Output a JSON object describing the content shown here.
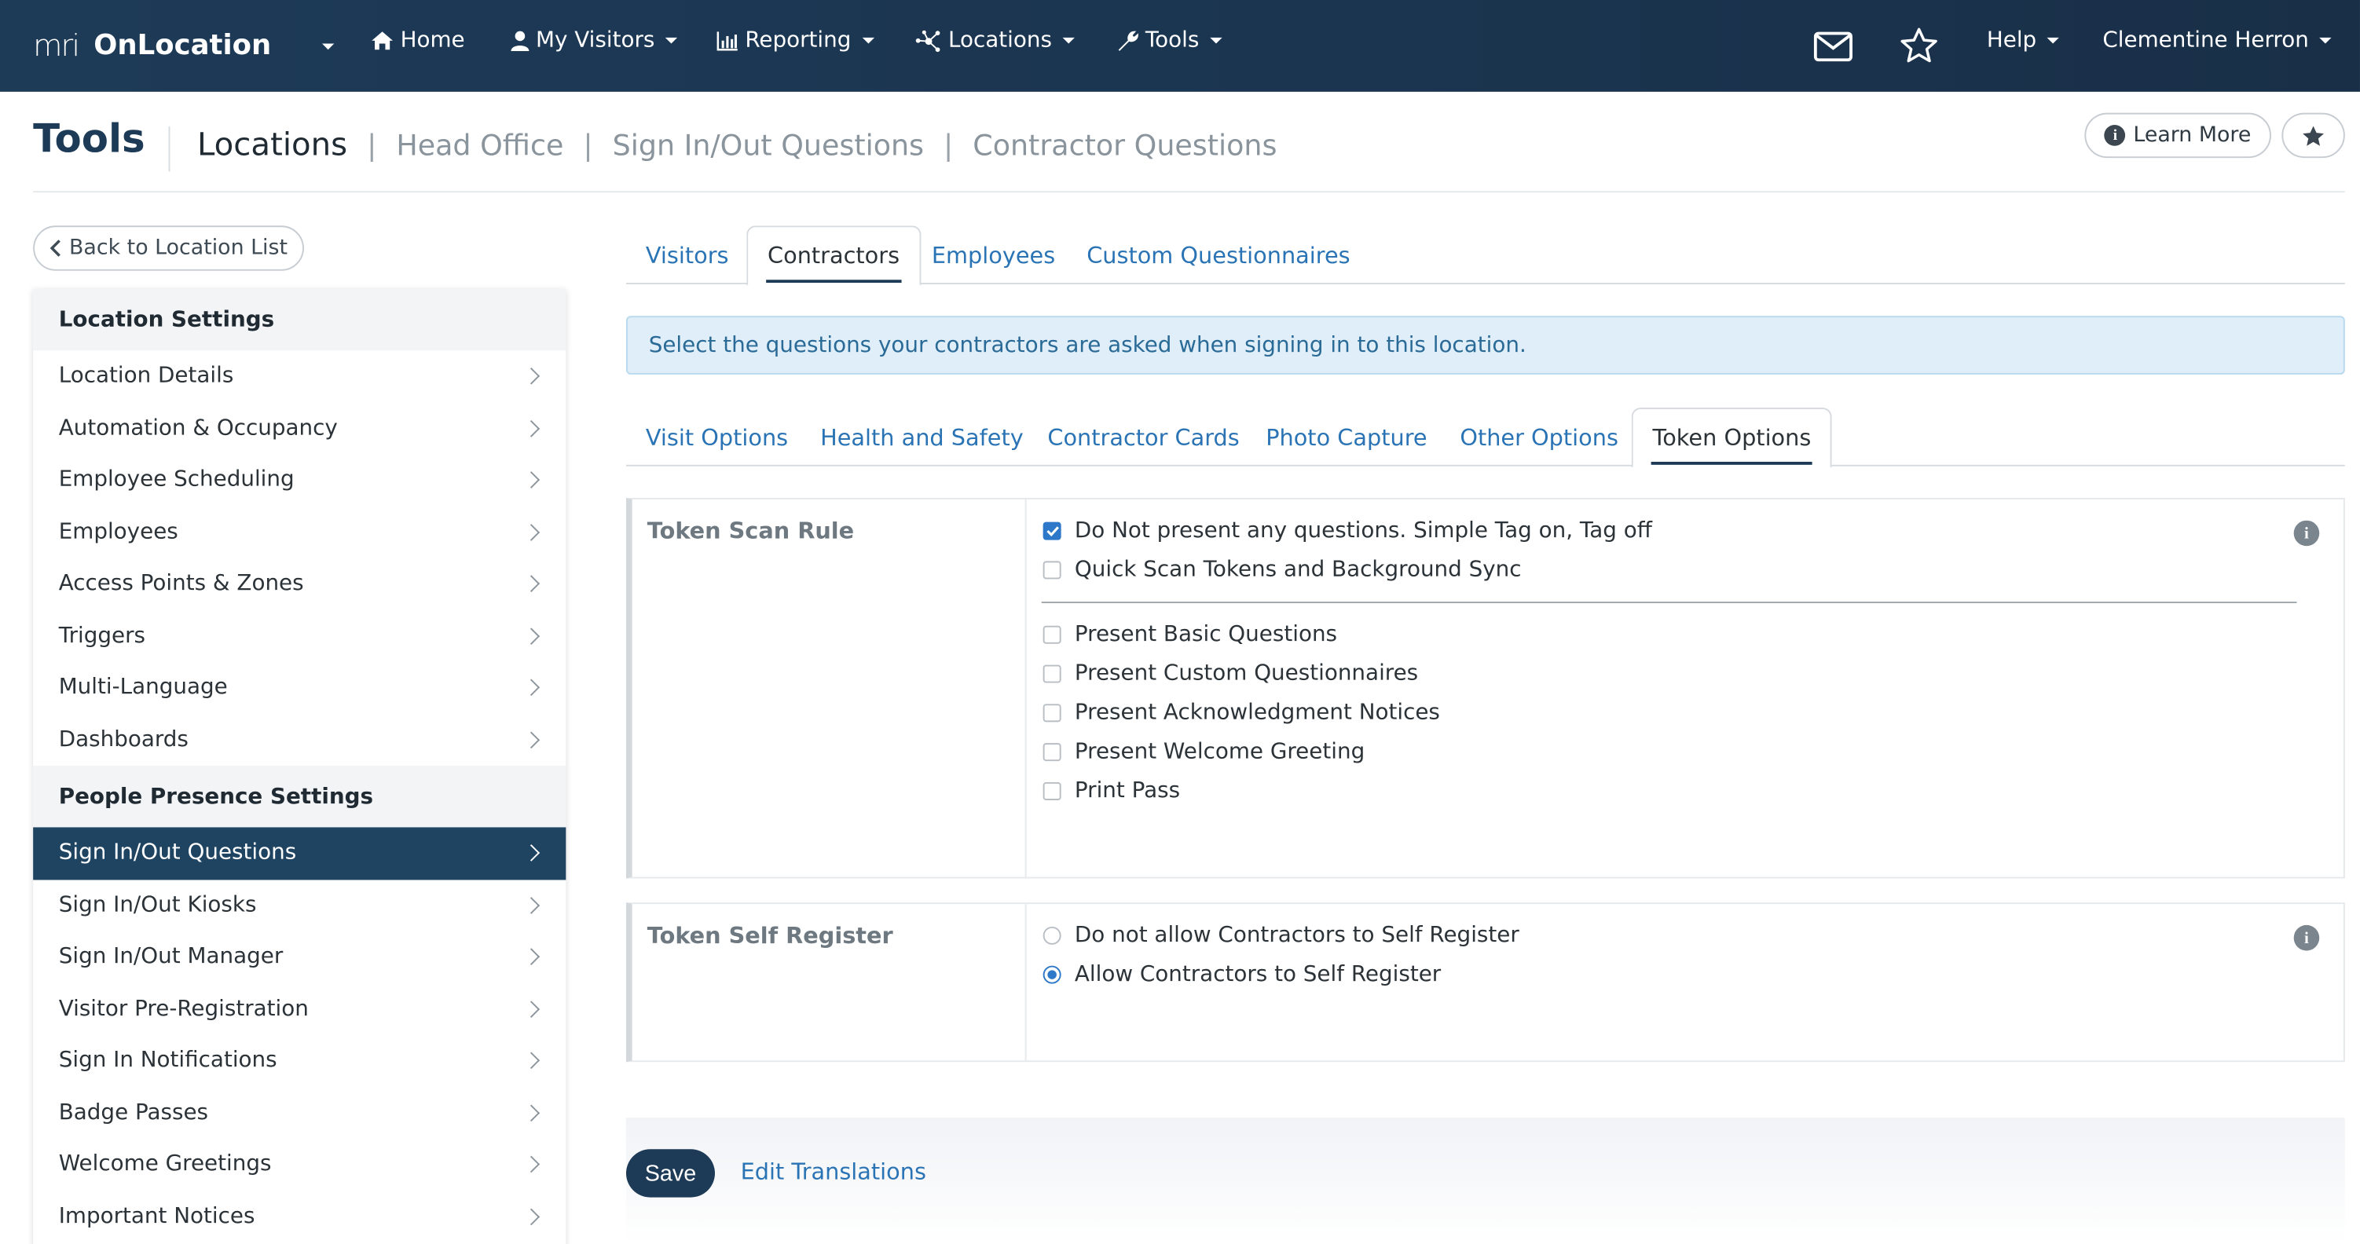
{
  "nav": {
    "logo_mark": "mri",
    "app_name": "OnLocation",
    "items": [
      {
        "label": "Home",
        "icon": "home-icon"
      },
      {
        "label": "My Visitors",
        "icon": "user-icon"
      },
      {
        "label": "Reporting",
        "icon": "bar-chart-icon"
      },
      {
        "label": "Locations",
        "icon": "network-icon"
      },
      {
        "label": "Tools",
        "icon": "wrench-icon"
      }
    ],
    "mail_icon": "mail-icon",
    "star_icon": "star-icon",
    "help_label": "Help",
    "user_name": "Clementine Herron"
  },
  "header": {
    "title": "Tools",
    "breadcrumb": [
      "Locations",
      "Head Office",
      "Sign In/Out Questions",
      "Contractor Questions"
    ],
    "learn_more": "Learn More"
  },
  "sidebar": {
    "back_label": "Back to Location List",
    "location_settings_title": "Location Settings",
    "location_settings": [
      "Location Details",
      "Automation & Occupancy",
      "Employee Scheduling",
      "Employees",
      "Access Points & Zones",
      "Triggers",
      "Multi-Language",
      "Dashboards"
    ],
    "presence_settings_title": "People Presence Settings",
    "presence_settings": [
      "Sign In/Out Questions",
      "Sign In/Out Kiosks",
      "Sign In/Out Manager",
      "Visitor Pre-Registration",
      "Sign In Notifications",
      "Badge Passes",
      "Welcome Greetings",
      "Important Notices"
    ],
    "active_item": "Sign In/Out Questions"
  },
  "tabs": [
    "Visitors",
    "Contractors",
    "Employees",
    "Custom Questionnaires"
  ],
  "active_tab": "Contractors",
  "banner": "Select the questions your contractors are asked when signing in to this location.",
  "subtabs": [
    "Visit Options",
    "Health and Safety",
    "Contractor Cards",
    "Photo Capture",
    "Other Options",
    "Token Options"
  ],
  "active_subtab": "Token Options",
  "token_scan_rule": {
    "label": "Token Scan Rule",
    "primary_options": [
      {
        "label": "Do Not present any questions. Simple Tag on, Tag off",
        "checked": true
      },
      {
        "label": "Quick Scan Tokens and Background Sync",
        "checked": false
      }
    ],
    "secondary_options": [
      {
        "label": "Present Basic Questions",
        "checked": false
      },
      {
        "label": "Present Custom Questionnaires",
        "checked": false
      },
      {
        "label": "Present Acknowledgment Notices",
        "checked": false
      },
      {
        "label": "Present Welcome Greeting",
        "checked": false
      },
      {
        "label": "Print Pass",
        "checked": false
      }
    ]
  },
  "token_self_register": {
    "label": "Token Self Register",
    "options": [
      {
        "label": "Do not allow Contractors to Self Register",
        "selected": false
      },
      {
        "label": "Allow Contractors to Self Register",
        "selected": true
      }
    ]
  },
  "footer": {
    "save": "Save",
    "edit_translations": "Edit Translations"
  },
  "colors": {
    "nav_bg": "#1d3a57",
    "accent_link": "#2a74b5",
    "active_sidebar": "#1f4462",
    "checkbox_blue": "#2d78c8",
    "banner_bg": "#dfeef8"
  }
}
